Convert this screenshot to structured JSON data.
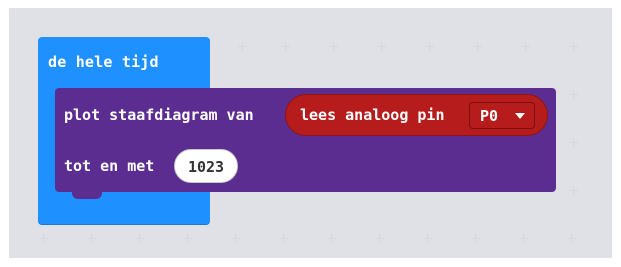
{
  "forever": {
    "label": "de hele tijd"
  },
  "plot_bar_graph": {
    "label": "plot staafdiagram van",
    "upto_label": "tot en met",
    "upto_value": "1023"
  },
  "analog_read": {
    "label": "lees analoog pin",
    "pin": "P0",
    "dropdown_icon": "chevron-down-icon"
  },
  "colors": {
    "forever_block": "#1e90ff",
    "plot_block": "#5c2d91",
    "analog_block": "#b71c1c",
    "workspace": "#ecedf0"
  }
}
